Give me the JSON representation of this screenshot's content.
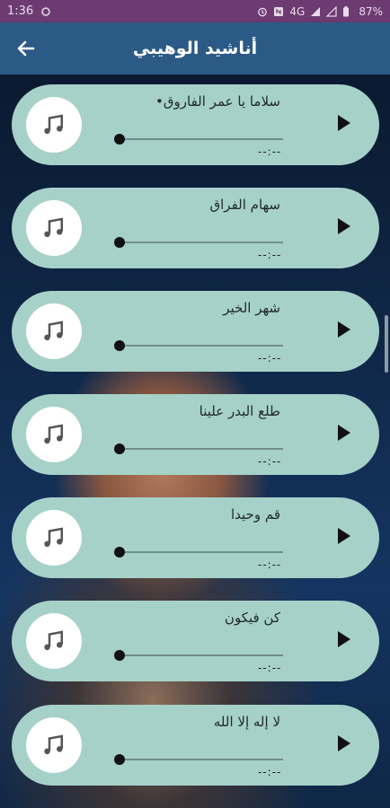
{
  "status_bar": {
    "time": "1:36",
    "network": "4G",
    "battery": "87%"
  },
  "app_bar": {
    "title": "أناشيد الوهيبي"
  },
  "tracks": [
    {
      "title": "سلاما يا عمر الفاروق•",
      "time": "--:--"
    },
    {
      "title": "سهام الفراق",
      "time": "--:--"
    },
    {
      "title": "شهر الخير",
      "time": "--:--"
    },
    {
      "title": "طلع البدر علينا",
      "time": "--:--"
    },
    {
      "title": "قم وحيدا",
      "time": "--:--"
    },
    {
      "title": "كن فيكون",
      "time": "--:--"
    },
    {
      "title": "لا إله إلا الله",
      "time": "--:--"
    }
  ],
  "colors": {
    "status_bar": "#6d3b72",
    "app_bar": "#2c5a86",
    "card": "#a6d1c8"
  }
}
